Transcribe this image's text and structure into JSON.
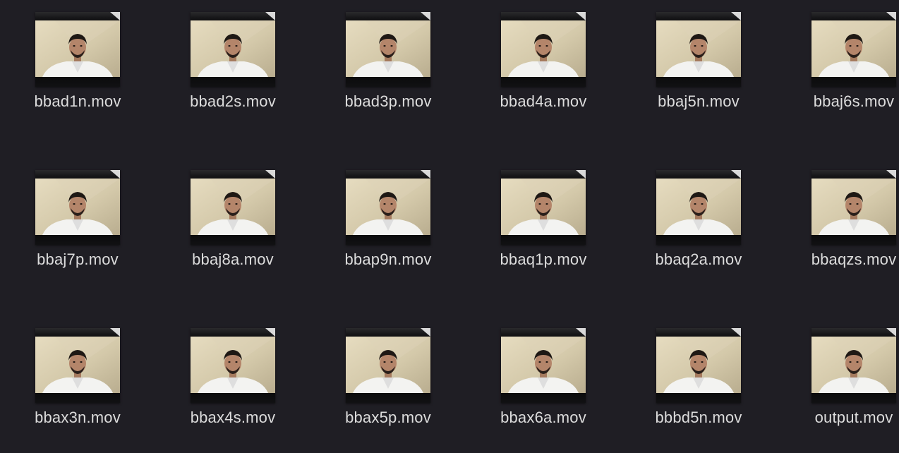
{
  "finder": {
    "view": "icon",
    "icon_kind": "video-thumbnail",
    "files": [
      {
        "name": "bbad1n.mov"
      },
      {
        "name": "bbad2s.mov"
      },
      {
        "name": "bbad3p.mov"
      },
      {
        "name": "bbad4a.mov"
      },
      {
        "name": "bbaj5n.mov"
      },
      {
        "name": "bbaj6s.mov"
      },
      {
        "name": "bbaj7p.mov"
      },
      {
        "name": "bbaj8a.mov"
      },
      {
        "name": "bbap9n.mov"
      },
      {
        "name": "bbaq1p.mov"
      },
      {
        "name": "bbaq2a.mov"
      },
      {
        "name": "bbaqzs.mov"
      },
      {
        "name": "bbax3n.mov"
      },
      {
        "name": "bbax4s.mov"
      },
      {
        "name": "bbax5p.mov"
      },
      {
        "name": "bbax6a.mov"
      },
      {
        "name": "bbbd5n.mov"
      },
      {
        "name": "output.mov"
      }
    ]
  },
  "colors": {
    "background": "#1f1e24",
    "label_text": "#dcdcdc",
    "thumbnail_wall": "#d9cfb4",
    "thumbnail_shirt": "#f2f2f0"
  }
}
